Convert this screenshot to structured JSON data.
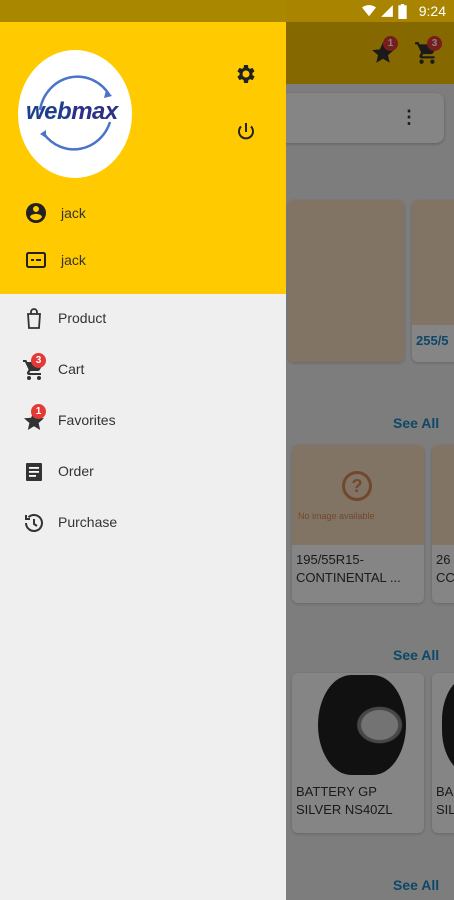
{
  "status_bar": {
    "time": "9:24"
  },
  "app_toolbar": {
    "favorites_count": "1",
    "cart_count": "3"
  },
  "background": {
    "card_top_right_text": "255/5",
    "see_all_1": "See All",
    "see_all_2": "See All",
    "see_all_3": "See All",
    "card_no_image_text": "No image available",
    "card_tyre_1": "195/55R15-\nCONTINENTAL ...",
    "card_tyre_2": "26\nCC",
    "card_battery_1": "BATTERY GP\nSILVER NS40ZL",
    "card_battery_2": "BA\nSIL"
  },
  "drawer": {
    "logo": {
      "web": "web",
      "max": "max"
    },
    "user": {
      "name": "jack",
      "id_label": "jack"
    },
    "menu": [
      {
        "label": "Product",
        "icon": "shopping-bag-icon"
      },
      {
        "label": "Cart",
        "icon": "cart-icon",
        "badge": "3"
      },
      {
        "label": "Favorites",
        "icon": "star-icon",
        "badge": "1"
      },
      {
        "label": "Order",
        "icon": "order-list-icon"
      },
      {
        "label": "Purchase",
        "icon": "history-icon"
      }
    ]
  },
  "colors": {
    "primary": "#ffca00",
    "badge": "#e53935",
    "link": "#1e88c7",
    "drawer_bg": "#efefef"
  }
}
